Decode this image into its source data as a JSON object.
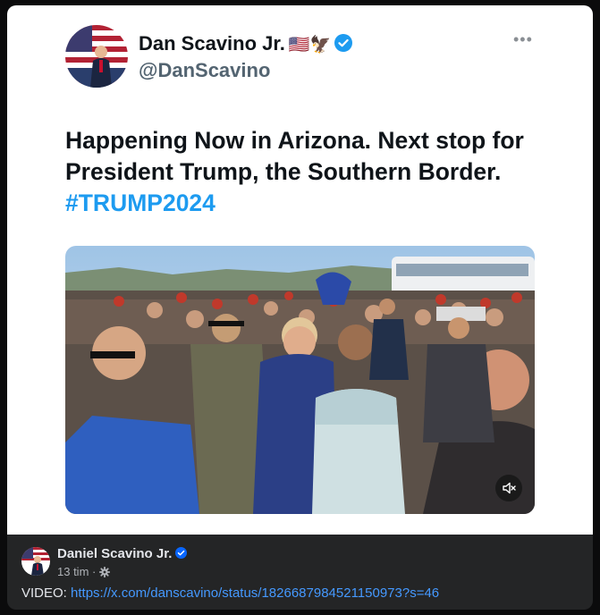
{
  "tweet": {
    "display_name": "Dan Scavino Jr.",
    "name_emoji": "🇺🇸🦅",
    "handle": "@DanScavino",
    "more_icon": "more-horizontal-icon",
    "text": "Happening Now in Arizona. Next stop for President Trump, the Southern Border.",
    "hashtag": "#TRUMP2024",
    "verified_color": "#1d9bf0"
  },
  "video": {
    "mute_icon": "speaker-muted-icon"
  },
  "post": {
    "author": "Daniel Scavino Jr.",
    "time": "13 tim",
    "separator": "·",
    "audience_icon": "gear-icon",
    "body_prefix": "VIDEO:",
    "link": "https://x.com/danscavino/status/1826687984521150973?s=46",
    "link_color": "#4599ff",
    "verified_color": "#0866ff"
  }
}
